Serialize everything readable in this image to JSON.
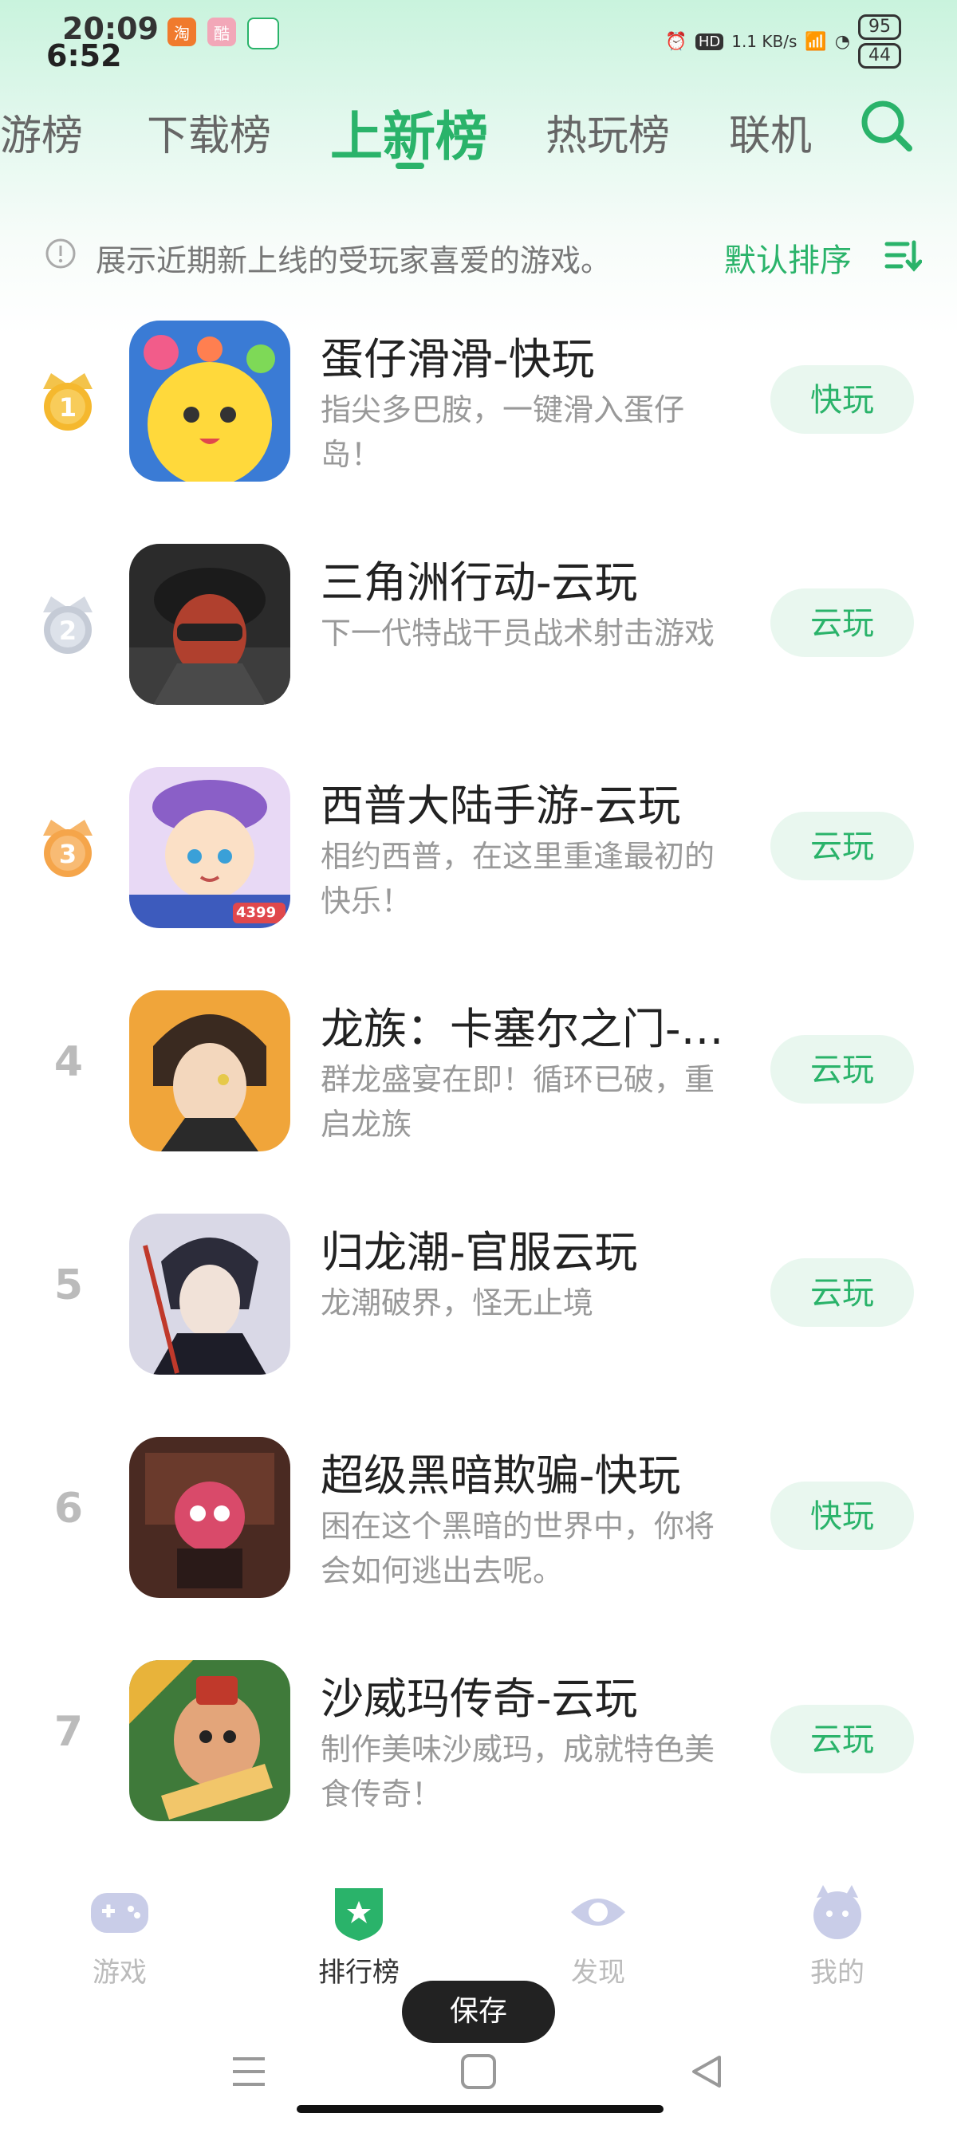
{
  "status_bar": {
    "time_top": "20:09",
    "time_main": "6:52",
    "net_speed": "1.1 KB/s",
    "battery_top": "95",
    "battery_main": "44"
  },
  "tabs": [
    {
      "label": "游榜"
    },
    {
      "label": "下载榜"
    },
    {
      "label": "上新榜",
      "active": true
    },
    {
      "label": "热玩榜"
    },
    {
      "label": "联机"
    }
  ],
  "info": {
    "text": "展示近期新上线的受玩家喜爱的游戏。",
    "sort_label": "默认排序"
  },
  "games": [
    {
      "rank": "1",
      "title": "蛋仔滑滑-快玩",
      "desc": "指尖多巴胺，一键滑入蛋仔岛！",
      "button": "快玩"
    },
    {
      "rank": "2",
      "title": "三角洲行动-云玩",
      "desc": "下一代特战干员战术射击游戏",
      "button": "云玩"
    },
    {
      "rank": "3",
      "title": "西普大陆手游-云玩",
      "desc": "相约西普，在这里重逢最初的快乐！",
      "button": "云玩",
      "icon_badge": "4399"
    },
    {
      "rank": "4",
      "title": "龙族：卡塞尔之门-官...",
      "desc": "群龙盛宴在即！循环已破，重启龙族",
      "button": "云玩"
    },
    {
      "rank": "5",
      "title": "归龙潮-官服云玩",
      "desc": "龙潮破界，怪无止境",
      "button": "云玩"
    },
    {
      "rank": "6",
      "title": "超级黑暗欺骗-快玩",
      "desc": "困在这个黑暗的世界中，你将会如何逃出去呢。",
      "button": "快玩"
    },
    {
      "rank": "7",
      "title": "沙威玛传奇-云玩",
      "desc": "制作美味沙威玛，成就特色美食传奇！",
      "button": "云玩"
    }
  ],
  "bottom_nav": [
    {
      "label": "游戏"
    },
    {
      "label": "排行榜",
      "active": true
    },
    {
      "label": "发现"
    },
    {
      "label": "我的"
    }
  ],
  "toast": "保存",
  "colors": {
    "accent": "#2ab36a",
    "gold": "#f5b82e",
    "silver": "#c5cbd6",
    "bronze": "#f5a54a"
  }
}
